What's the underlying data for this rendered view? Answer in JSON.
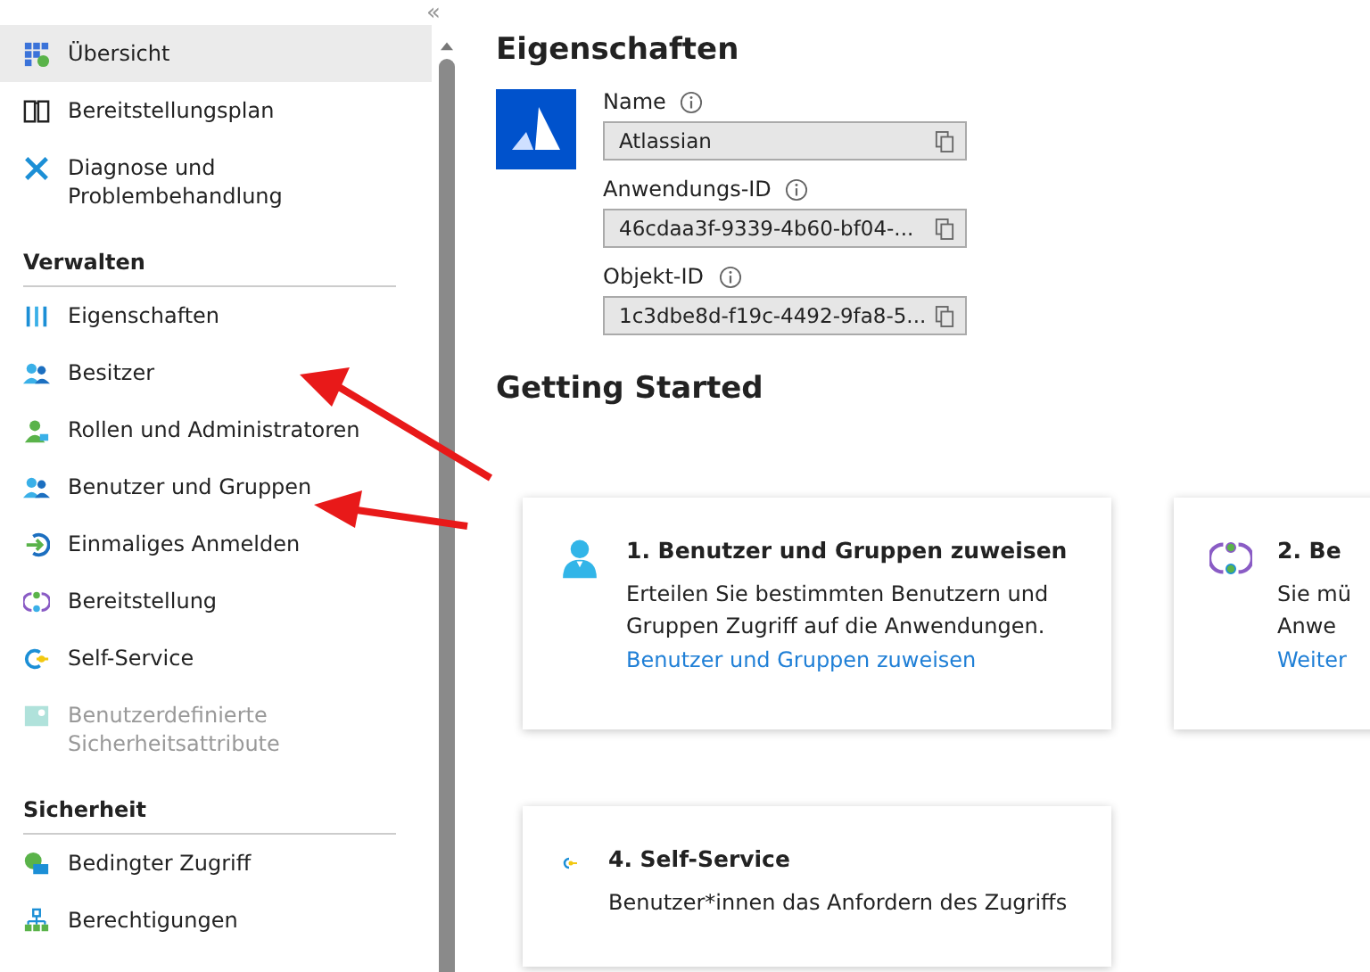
{
  "sidebar": {
    "collapse": "«",
    "sections": [
      {
        "items": [
          {
            "label": "Übersicht",
            "selected": true,
            "disabled": false
          },
          {
            "label": "Bereitstellungsplan",
            "selected": false,
            "disabled": false
          },
          {
            "label": "Diagnose und Problembehandlung",
            "selected": false,
            "disabled": false
          }
        ]
      },
      {
        "title": "Verwalten",
        "items": [
          {
            "label": "Eigenschaften",
            "selected": false,
            "disabled": false
          },
          {
            "label": "Besitzer",
            "selected": false,
            "disabled": false
          },
          {
            "label": "Rollen und Administratoren",
            "selected": false,
            "disabled": false
          },
          {
            "label": "Benutzer und Gruppen",
            "selected": false,
            "disabled": false
          },
          {
            "label": "Einmaliges Anmelden",
            "selected": false,
            "disabled": false
          },
          {
            "label": "Bereitstellung",
            "selected": false,
            "disabled": false
          },
          {
            "label": "Self-Service",
            "selected": false,
            "disabled": false
          },
          {
            "label": "Benutzerdefinierte Sicherheitsattribute",
            "selected": false,
            "disabled": true
          }
        ]
      },
      {
        "title": "Sicherheit",
        "items": [
          {
            "label": "Bedingter Zugriff",
            "selected": false,
            "disabled": false
          },
          {
            "label": "Berechtigungen",
            "selected": false,
            "disabled": false
          }
        ]
      }
    ]
  },
  "properties": {
    "title": "Eigenschaften",
    "fields": [
      {
        "label": "Name",
        "value": "Atlassian"
      },
      {
        "label": "Anwendungs-ID",
        "value": "46cdaa3f-9339-4b60-bf04-..."
      },
      {
        "label": "Objekt-ID",
        "value": "1c3dbe8d-f19c-4492-9fa8-5..."
      }
    ]
  },
  "getting_started": {
    "title": "Getting Started",
    "cards": [
      {
        "title": "1. Benutzer und Gruppen zuweisen",
        "text": "Erteilen Sie bestimmten Benutzern und Gruppen Zugriff auf die Anwendungen.",
        "link": "Benutzer und Gruppen zuweisen"
      },
      {
        "title": "2. Be",
        "text": "Sie mü\nAnwe",
        "link": "Weiter"
      },
      {
        "title": "4. Self-Service",
        "text": "Benutzer*innen das Anfordern des Zugriffs"
      }
    ]
  },
  "annotations": [
    {
      "kind": "arrow"
    },
    {
      "kind": "arrow"
    }
  ]
}
